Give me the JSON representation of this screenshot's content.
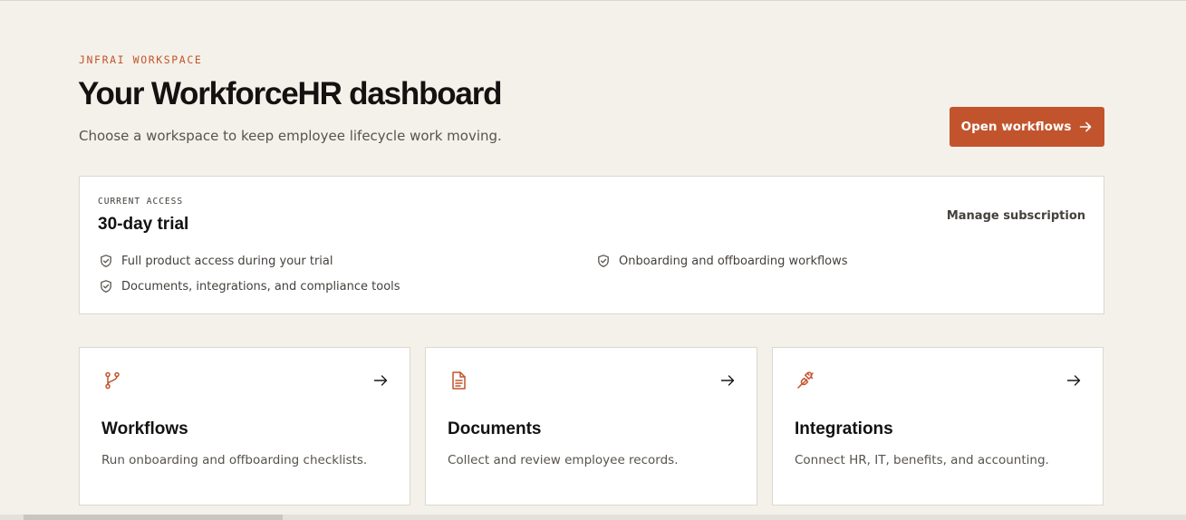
{
  "header": {
    "eyebrow": "JNFRAI WORKSPACE",
    "title": "Your WorkforceHR dashboard",
    "subtitle": "Choose a workspace to keep employee lifecycle work moving.",
    "primary_button": {
      "label": "Open workflows",
      "icon": "arrow-right-icon"
    }
  },
  "access": {
    "eyebrow": "CURRENT ACCESS",
    "title": "30-day trial",
    "manage_link": "Manage subscription",
    "features": [
      {
        "label": "Full product access during your trial",
        "icon": "shield-check-icon"
      },
      {
        "label": "Onboarding and offboarding workflows",
        "icon": "shield-check-icon"
      },
      {
        "label": "Documents, integrations, and compliance tools",
        "icon": "shield-check-icon"
      }
    ]
  },
  "tiles": [
    {
      "title": "Workflows",
      "description": "Run onboarding and offboarding checklists.",
      "icon": "git-branch-icon"
    },
    {
      "title": "Documents",
      "description": "Collect and review employee records.",
      "icon": "file-text-icon"
    },
    {
      "title": "Integrations",
      "description": "Connect HR, IT, benefits, and accounting.",
      "icon": "plug-icon"
    }
  ],
  "colors": {
    "accent": "#c2542d",
    "background": "#f4f1ea",
    "card": "#ffffff",
    "border": "#ddd8ce",
    "text": "#141210",
    "muted": "#57534e"
  }
}
